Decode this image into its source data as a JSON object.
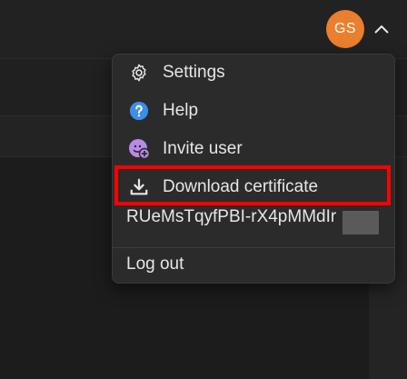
{
  "header": {
    "avatar_initials": "GS",
    "avatar_color": "#ea7f2d"
  },
  "menu": {
    "items": [
      {
        "label": "Settings",
        "icon": "gear-icon"
      },
      {
        "label": "Help",
        "icon": "help-circle-icon"
      },
      {
        "label": "Invite user",
        "icon": "add-user-icon"
      },
      {
        "label": "Download certificate",
        "icon": "download-icon"
      }
    ],
    "token_text": "RUeMsTqyfPBI-rX4pMMdIr",
    "logout_label": "Log out"
  },
  "colors": {
    "highlight": "#ff0000",
    "help_icon": "#3b8eea",
    "invite_icon": "#b98ae6"
  }
}
